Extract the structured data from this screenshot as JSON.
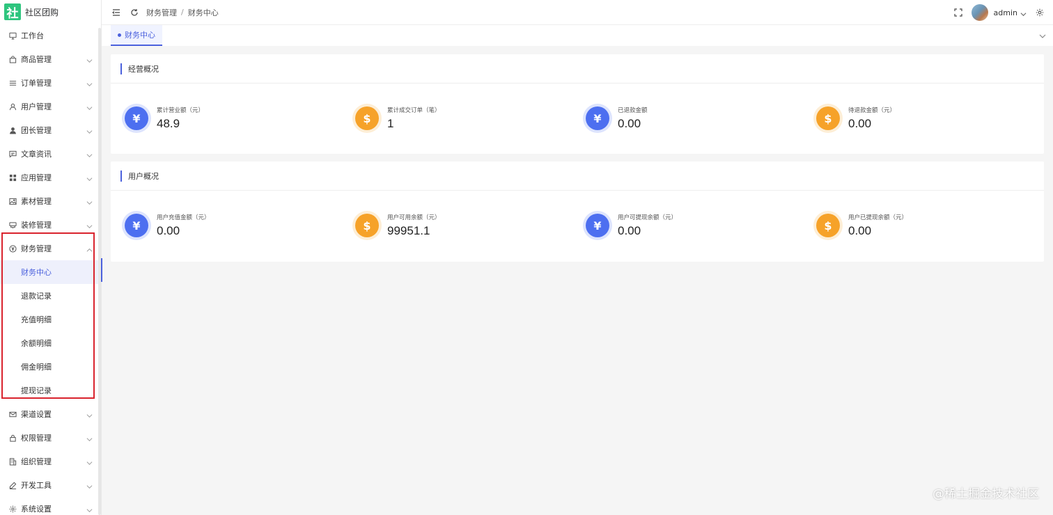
{
  "app": {
    "logo_char": "社",
    "title": "社区团购"
  },
  "sidebar": {
    "items_top": [
      {
        "label": "工作台",
        "icon": "monitor-icon",
        "has_arrow": false
      },
      {
        "label": "商品管理",
        "icon": "shopping-bag-icon",
        "has_arrow": true
      },
      {
        "label": "订单管理",
        "icon": "list-icon",
        "has_arrow": true
      },
      {
        "label": "用户管理",
        "icon": "user-icon",
        "has_arrow": true
      },
      {
        "label": "团长管理",
        "icon": "user-solid-icon",
        "has_arrow": true
      },
      {
        "label": "文章资讯",
        "icon": "message-icon",
        "has_arrow": true
      },
      {
        "label": "应用管理",
        "icon": "grid-icon",
        "has_arrow": true
      },
      {
        "label": "素材管理",
        "icon": "picture-icon",
        "has_arrow": true
      },
      {
        "label": "装修管理",
        "icon": "brush-icon",
        "has_arrow": true
      }
    ],
    "expanded": {
      "label": "财务管理",
      "icon": "yen-circle-icon",
      "children": [
        "财务中心",
        "退款记录",
        "充值明细",
        "余额明细",
        "佣金明细",
        "提现记录"
      ],
      "active_child": "财务中心"
    },
    "items_bottom": [
      {
        "label": "渠道设置",
        "icon": "mail-icon",
        "has_arrow": true
      },
      {
        "label": "权限管理",
        "icon": "lock-icon",
        "has_arrow": true
      },
      {
        "label": "组织管理",
        "icon": "office-icon",
        "has_arrow": true
      },
      {
        "label": "开发工具",
        "icon": "pen-icon",
        "has_arrow": true
      },
      {
        "label": "系统设置",
        "icon": "gear-icon",
        "has_arrow": true
      }
    ]
  },
  "header": {
    "breadcrumb": [
      "财务管理",
      "财务中心"
    ],
    "breadcrumb_sep": "/",
    "username": "admin"
  },
  "tabs": [
    {
      "label": "财务中心",
      "active": true
    }
  ],
  "sections": [
    {
      "title": "经营概况",
      "stats": [
        {
          "label": "累计营业额（元）",
          "value": "48.9",
          "icon": "yen-icon",
          "color": "blue"
        },
        {
          "label": "累计成交订单（笔）",
          "value": "1",
          "icon": "dollar-icon",
          "color": "orange"
        },
        {
          "label": "已退款金额",
          "value": "0.00",
          "icon": "yen-icon",
          "color": "blue"
        },
        {
          "label": "待退款金额（元）",
          "value": "0.00",
          "icon": "dollar-icon",
          "color": "orange"
        }
      ]
    },
    {
      "title": "用户概况",
      "stats": [
        {
          "label": "用户充值金额（元）",
          "value": "0.00",
          "icon": "yen-icon",
          "color": "blue"
        },
        {
          "label": "用户可用余额（元）",
          "value": "99951.1",
          "icon": "dollar-icon",
          "color": "orange"
        },
        {
          "label": "用户可提现余额（元）",
          "value": "0.00",
          "icon": "yen-icon",
          "color": "blue"
        },
        {
          "label": "用户已提现余额（元）",
          "value": "0.00",
          "icon": "dollar-icon",
          "color": "orange"
        }
      ]
    }
  ],
  "coin_glyphs": {
    "yen-icon": "¥",
    "dollar-icon": "$"
  },
  "colors": {
    "accent": "#4b61dd",
    "coin_blue": "#4d6ff0",
    "coin_orange": "#f6a229",
    "highlight_border": "#d9232d",
    "logo_green": "#2ec57e"
  },
  "watermark": "@稀土掘金技术社区"
}
